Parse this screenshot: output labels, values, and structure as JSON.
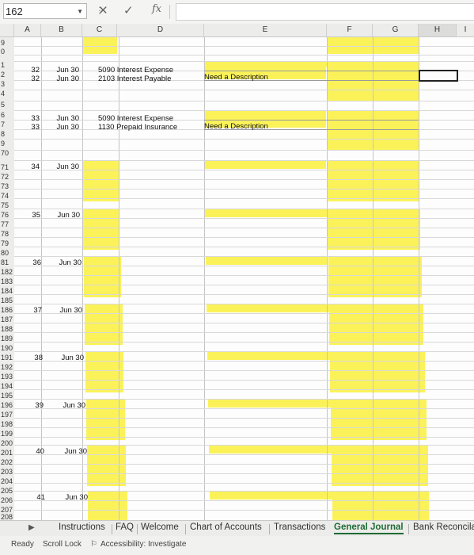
{
  "formula_bar": {
    "name_box": "162",
    "cancel_icon": "✕",
    "enter_icon": "✓",
    "fx_label": "fx"
  },
  "columns": [
    "A",
    "B",
    "C",
    "D",
    "E",
    "F",
    "G",
    "H",
    "I"
  ],
  "row_numbers": [
    "9",
    "0",
    "1",
    "2",
    "3",
    "4",
    "5",
    "6",
    "7",
    "8",
    "9",
    "70",
    "71",
    "72",
    "73",
    "74",
    "75",
    "76",
    "77",
    "78",
    "79",
    "80",
    "81",
    "182",
    "183",
    "184",
    "185",
    "186",
    "187",
    "188",
    "189",
    "190",
    "191",
    "192",
    "193",
    "194",
    "195",
    "196",
    "197",
    "198",
    "199",
    "200",
    "201",
    "202",
    "203",
    "204",
    "205",
    "206",
    "207",
    "208"
  ],
  "entries": [
    {
      "num": "32",
      "num2": "32",
      "date": "Jun 30",
      "date2": "Jun 30",
      "acct1": "5090 Interest Expense",
      "acct2": "2103 Interest Payable",
      "desc": "Need a Description"
    },
    {
      "num": "33",
      "num2": "33",
      "date": "Jun 30",
      "date2": "Jun 30",
      "acct1": "5090 Interest Expense",
      "acct2": "1130 Prepaid Insurance",
      "desc": "Need a Description"
    },
    {
      "num": "34",
      "date": "Jun 30"
    },
    {
      "num": "35",
      "date": "Jun 30"
    },
    {
      "num": "36",
      "date": "Jun 30"
    },
    {
      "num": "37",
      "date": "Jun 30"
    },
    {
      "num": "38",
      "date": "Jun 30"
    },
    {
      "num": "39",
      "date": "Jun 30"
    },
    {
      "num": "40",
      "date": "Jun 30"
    },
    {
      "num": "41",
      "date": "Jun 30"
    }
  ],
  "sheet_tabs": [
    "Instructions",
    "FAQ",
    "Welcome",
    "Chart of Accounts",
    "Transactions",
    "General Journal",
    "Bank Reconcila"
  ],
  "active_tab": "General Journal",
  "status_bar": {
    "ready": "Ready",
    "scroll_lock": "Scroll Lock",
    "accessibility": "Accessibility: Investigate"
  },
  "colors": {
    "highlight": "#fbf25a",
    "active_tab": "#1f6b35"
  }
}
